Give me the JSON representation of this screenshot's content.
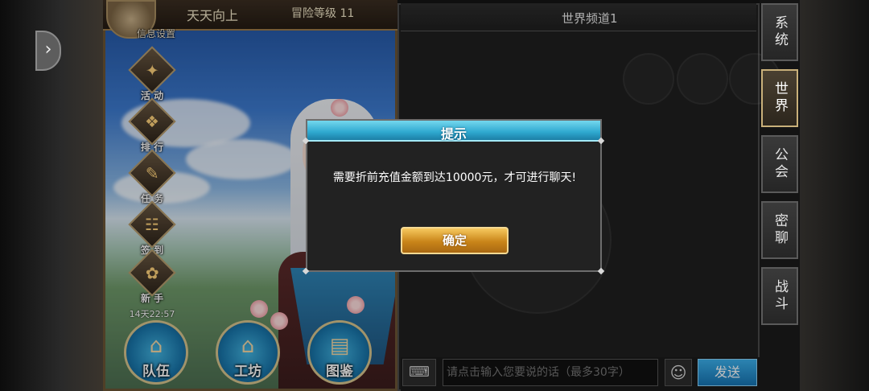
{
  "header": {
    "player_name": "天天向上",
    "level_text": "冒险等级 11",
    "info_settings": "信息设置"
  },
  "side_menu": [
    {
      "label": "活 动",
      "icon": "activity-icon"
    },
    {
      "label": "排 行",
      "icon": "ranking-icon"
    },
    {
      "label": "任 务",
      "icon": "quest-icon"
    },
    {
      "label": "签 到",
      "icon": "checkin-icon"
    },
    {
      "label": "新 手",
      "icon": "newbie-icon",
      "timer": "14天22:57"
    }
  ],
  "bottom_nav": [
    {
      "label": "队伍",
      "icon": "team-icon"
    },
    {
      "label": "工坊",
      "icon": "workshop-icon"
    },
    {
      "label": "图鉴",
      "icon": "codex-icon"
    }
  ],
  "chat": {
    "channel_title": "世界频道1",
    "input_placeholder": "请点击输入您要说的话（最多30字）",
    "send_label": "发送",
    "tabs": [
      {
        "label": "系统",
        "active": false
      },
      {
        "label": "世界",
        "active": true
      },
      {
        "label": "公会",
        "active": false
      },
      {
        "label": "密聊",
        "active": false
      },
      {
        "label": "战斗",
        "active": false
      }
    ]
  },
  "dialog": {
    "title": "提示",
    "message": "需要折前充值金额到达10000元，才可进行聊天!",
    "confirm_label": "确定"
  },
  "colors": {
    "accent_blue": "#2ea8cf",
    "confirm_gold": "#c98519",
    "send_blue": "#1674b3"
  }
}
